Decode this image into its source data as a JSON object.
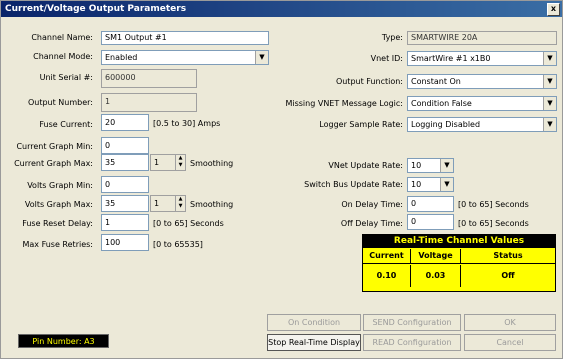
{
  "window": {
    "title": "Current/Voltage Output Parameters",
    "close": "x"
  },
  "left": {
    "channel_name": {
      "label": "Channel Name:",
      "value": "SM1 Output #1"
    },
    "channel_mode": {
      "label": "Channel Mode:",
      "value": "Enabled"
    },
    "unit_serial": {
      "label": "Unit Serial #:",
      "value": "600000"
    },
    "output_number": {
      "label": "Output Number:",
      "value": "1"
    },
    "fuse_current": {
      "label": "Fuse Current:",
      "value": "20",
      "note": "[0.5 to 30] Amps"
    },
    "current_graph_min": {
      "label": "Current Graph Min:",
      "value": "0"
    },
    "current_graph_max": {
      "label": "Current Graph Max:",
      "value": "35",
      "spin": "1",
      "note": "Smoothing"
    },
    "volts_graph_min": {
      "label": "Volts Graph Min:",
      "value": "0"
    },
    "volts_graph_max": {
      "label": "Volts Graph Max:",
      "value": "35",
      "spin": "1",
      "note": "Smoothing"
    },
    "fuse_reset_delay": {
      "label": "Fuse Reset Delay:",
      "value": "1",
      "note": "[0 to 65] Seconds"
    },
    "max_fuse_retries": {
      "label": "Max Fuse Retries:",
      "value": "100",
      "note": "[0 to 65535]"
    }
  },
  "right": {
    "type": {
      "label": "Type:",
      "value": "SMARTWIRE 20A"
    },
    "vnet_id": {
      "label": "Vnet ID:",
      "value": "SmartWire #1  x1B0"
    },
    "output_function": {
      "label": "Output Function:",
      "value": "Constant On"
    },
    "missing_vnet": {
      "label": "Missing VNET Message Logic:",
      "value": "Condition False"
    },
    "logger_rate": {
      "label": "Logger Sample Rate:",
      "value": "Logging Disabled"
    },
    "vnet_update_rate": {
      "label": "VNet Update Rate:",
      "value": "10"
    },
    "switch_bus_rate": {
      "label": "Switch Bus Update Rate:",
      "value": "10"
    },
    "on_delay": {
      "label": "On Delay Time:",
      "value": "0",
      "note": "[0 to 65] Seconds"
    },
    "off_delay": {
      "label": "Off Delay Time:",
      "value": "0",
      "note": "[0 to 65] Seconds"
    }
  },
  "realtime": {
    "title": "Real-Time Channel Values",
    "headers": [
      "Current",
      "Voltage",
      "Status"
    ],
    "values": [
      "0.10",
      "0.03",
      "Off"
    ]
  },
  "buttons": {
    "on_condition": "On Condition",
    "send_config": "SEND Configuration",
    "ok": "OK",
    "stop_rt": "Stop Real-Time Display",
    "read_config": "READ Configuration",
    "cancel": "Cancel"
  },
  "pin": "Pin Number: A3",
  "colors": {
    "titlebar": "#0a246a",
    "panel": "#ece9d8",
    "highlight": "#ffff00"
  }
}
